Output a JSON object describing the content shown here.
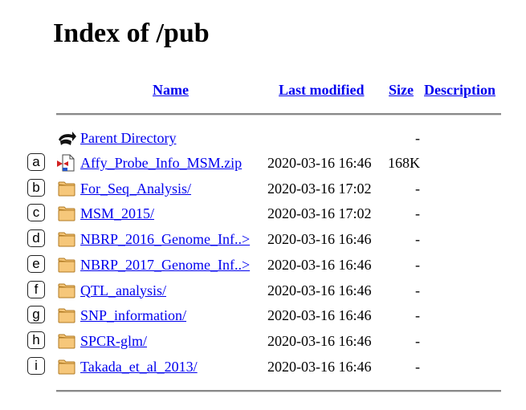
{
  "page": {
    "title": "Index of /pub"
  },
  "columns": {
    "name": "Name",
    "last_modified": "Last modified",
    "size": "Size",
    "description": "Description"
  },
  "parent": {
    "icon": "back-arrow-icon",
    "label": "Parent Directory",
    "size": "-"
  },
  "entries": [
    {
      "marker": "a",
      "icon": "binary-file-icon",
      "name": "Affy_Probe_Info_MSM.zip",
      "modified": "2020-03-16 16:46",
      "size": "168K"
    },
    {
      "marker": "b",
      "icon": "folder-icon",
      "name": "For_Seq_Analysis/",
      "modified": "2020-03-16 17:02",
      "size": "-"
    },
    {
      "marker": "c",
      "icon": "folder-icon",
      "name": "MSM_2015/",
      "modified": "2020-03-16 17:02",
      "size": "-"
    },
    {
      "marker": "d",
      "icon": "folder-icon",
      "name": "NBRP_2016_Genome_Inf..>",
      "modified": "2020-03-16 16:46",
      "size": "-"
    },
    {
      "marker": "e",
      "icon": "folder-icon",
      "name": "NBRP_2017_Genome_Inf..>",
      "modified": "2020-03-16 16:46",
      "size": "-"
    },
    {
      "marker": "f",
      "icon": "folder-icon",
      "name": "QTL_analysis/",
      "modified": "2020-03-16 16:46",
      "size": "-"
    },
    {
      "marker": "g",
      "icon": "folder-icon",
      "name": "SNP_information/",
      "modified": "2020-03-16 16:46",
      "size": "-"
    },
    {
      "marker": "h",
      "icon": "folder-icon",
      "name": "SPCR-glm/",
      "modified": "2020-03-16 16:46",
      "size": "-"
    },
    {
      "marker": "i",
      "icon": "folder-icon",
      "name": "Takada_et_al_2013/",
      "modified": "2020-03-16 16:46",
      "size": "-"
    }
  ],
  "colors": {
    "link": "#0000ee",
    "rule": "#888888",
    "folder_fill": "#f6c77a",
    "folder_stroke": "#b07a22"
  }
}
